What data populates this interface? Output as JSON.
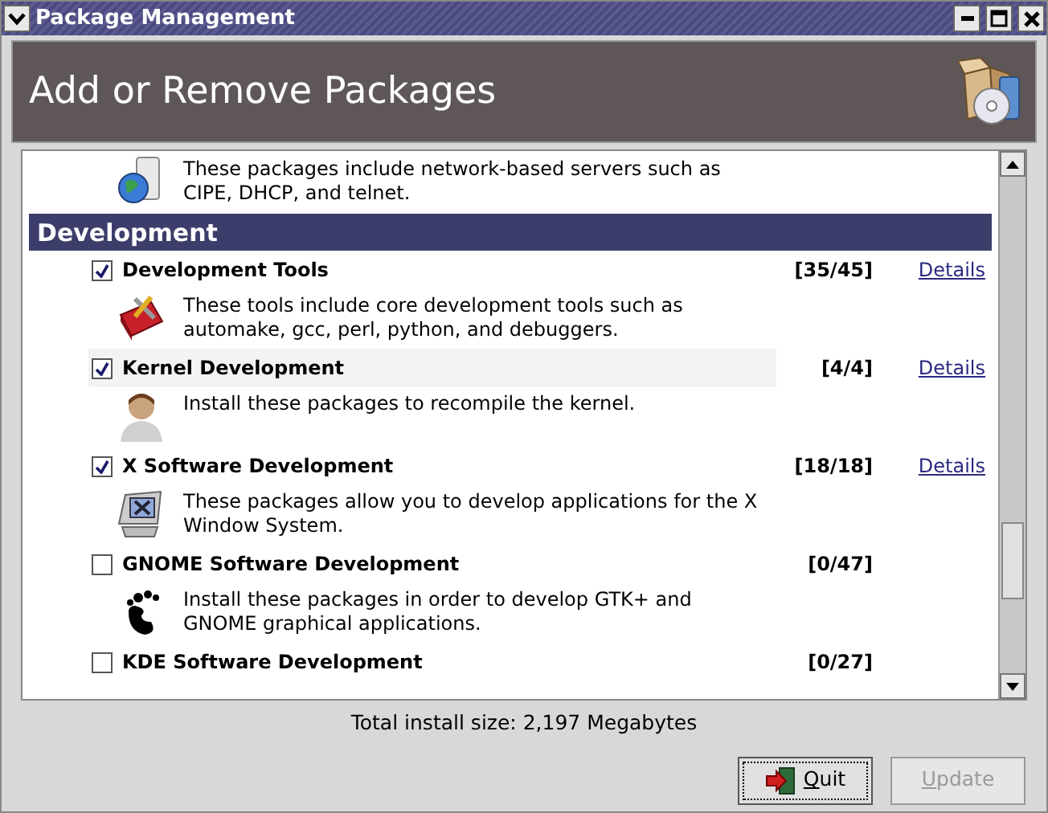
{
  "window": {
    "title": "Package Management"
  },
  "header": {
    "title": "Add or Remove Packages"
  },
  "list": {
    "items": [
      {
        "kind": "tail",
        "lines": [
          "These packages include network-based servers such as",
          "CIPE, DHCP, and telnet."
        ]
      },
      {
        "kind": "section",
        "title": "Development"
      },
      {
        "kind": "package",
        "name": "Development Tools",
        "checked": true,
        "selected": false,
        "count": "[35/45]",
        "details": "Details",
        "lines": [
          "These tools include core development tools such as",
          "automake, gcc, perl, python, and debuggers."
        ]
      },
      {
        "kind": "package",
        "name": "Kernel Development",
        "checked": true,
        "selected": true,
        "count": "[4/4]",
        "details": "Details",
        "lines": [
          "Install these packages to recompile the kernel."
        ]
      },
      {
        "kind": "package",
        "name": "X Software Development",
        "checked": true,
        "selected": false,
        "count": "[18/18]",
        "details": "Details",
        "lines": [
          "These packages allow you to develop applications for the X",
          "Window System."
        ]
      },
      {
        "kind": "package",
        "name": "GNOME Software Development",
        "checked": false,
        "selected": false,
        "count": "[0/47]",
        "lines": [
          "Install these packages in order to develop GTK+ and",
          "GNOME graphical applications."
        ]
      },
      {
        "kind": "package",
        "name": "KDE Software Development",
        "checked": false,
        "selected": false,
        "count": "[0/27]"
      }
    ]
  },
  "total": "Total install size: 2,197 Megabytes",
  "buttons": [
    {
      "label": "Quit",
      "disabled": false,
      "focused": true
    },
    {
      "label": "Update",
      "disabled": true,
      "focused": false
    }
  ]
}
